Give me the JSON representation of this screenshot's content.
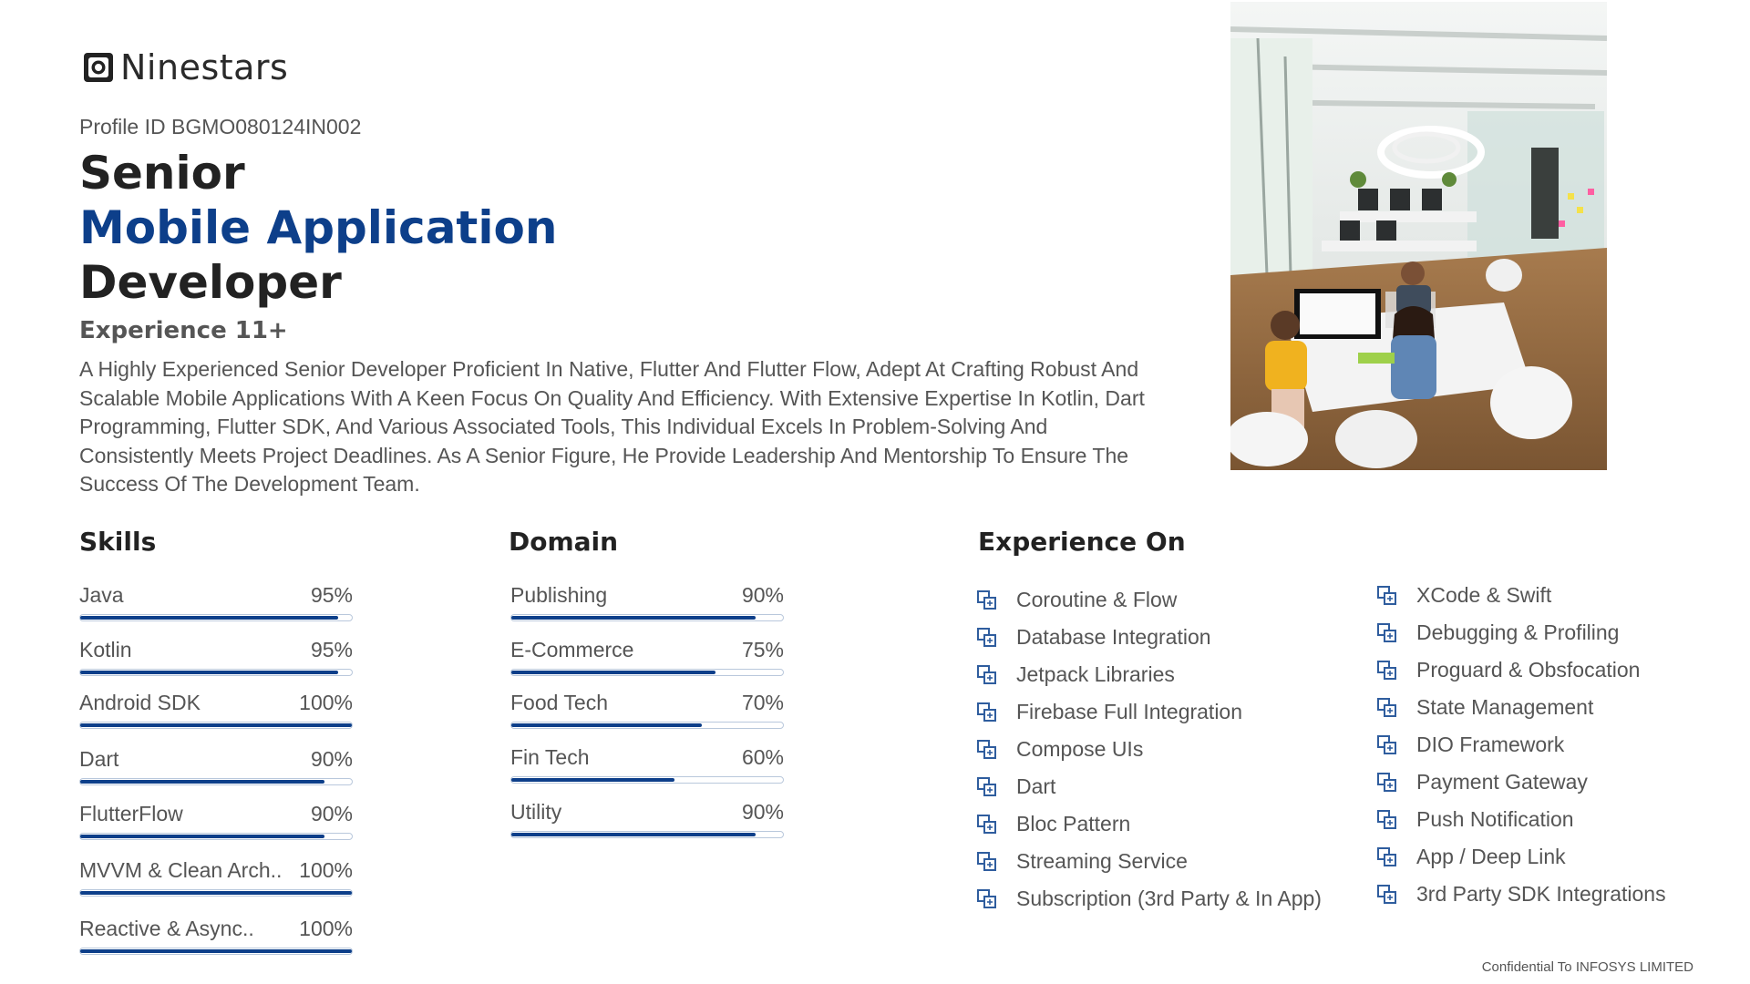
{
  "brand": {
    "name": "Ninestars"
  },
  "profile": {
    "id_text": "Profile ID BGMO080124IN002",
    "title_line1": "Senior",
    "title_line2": "Mobile Application",
    "title_line3": "Developer",
    "experience": "Experience 11+",
    "summary": "A Highly Experienced Senior Developer Proficient In Native, Flutter And Flutter Flow, Adept At Crafting Robust And Scalable Mobile Applications With A Keen Focus On Quality And Efficiency. With Extensive Expertise In Kotlin, Dart Programming, Flutter SDK, And Various Associated Tools, This Individual Excels In Problem-Solving And Consistently Meets Project Deadlines.  As A Senior Figure, He Provide Leadership And Mentorship To Ensure The Success Of The Development Team."
  },
  "skills": {
    "title": "Skills",
    "items": [
      {
        "label": "Java",
        "value_text": "95%",
        "value": 95
      },
      {
        "label": "Kotlin",
        "value_text": "95%",
        "value": 95
      },
      {
        "label": "Android SDK",
        "value_text": "100%",
        "value": 100
      },
      {
        "label": "Dart",
        "value_text": "90%",
        "value": 90
      },
      {
        "label": "FlutterFlow",
        "value_text": "90%",
        "value": 90
      },
      {
        "label": "MVVM & Clean Arch..",
        "value_text": "100%",
        "value": 100
      },
      {
        "label": "Reactive & Async..",
        "value_text": "100%",
        "value": 100
      }
    ]
  },
  "domain": {
    "title": "Domain",
    "items": [
      {
        "label": "Publishing",
        "value_text": "90%",
        "value": 90
      },
      {
        "label": "E-Commerce",
        "value_text": "75%",
        "value": 75
      },
      {
        "label": "Food Tech",
        "value_text": "70%",
        "value": 70
      },
      {
        "label": "Fin Tech",
        "value_text": "60%",
        "value": 60
      },
      {
        "label": "Utility",
        "value_text": "90%",
        "value": 90
      }
    ]
  },
  "experience_on": {
    "title": "Experience On",
    "icon": "copy-squares-icon",
    "column1": [
      "Coroutine & Flow",
      "Database Integration",
      "Jetpack Libraries",
      "Firebase Full Integration",
      "Compose UIs",
      "Dart",
      "Bloc Pattern",
      "Streaming Service",
      "Subscription (3rd Party & In App)"
    ],
    "column2": [
      "XCode & Swift",
      "Debugging & Profiling",
      "Proguard & Obsfocation",
      "State Management",
      "DIO Framework",
      "Payment Gateway",
      "Push Notification",
      "App / Deep Link",
      "3rd Party SDK Integrations"
    ]
  },
  "footer": {
    "text": "Confidential To INFOSYS LIMITED"
  },
  "colors": {
    "accent": "#0d3f8a",
    "text": "#555555",
    "heading": "#222222"
  }
}
